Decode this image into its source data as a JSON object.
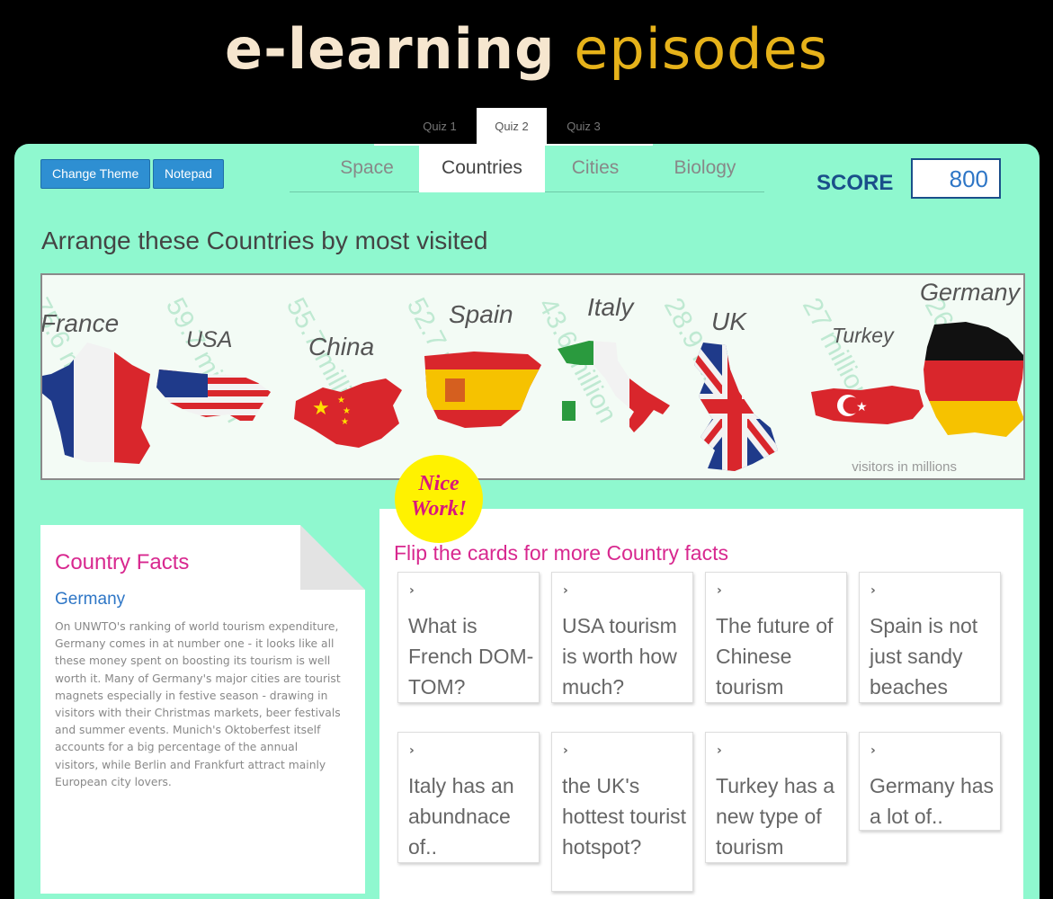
{
  "logo": {
    "word1": "e-learning",
    "word2": "episodes"
  },
  "quiz_tabs": [
    "Quiz 1",
    "Quiz 2",
    "Quiz 3"
  ],
  "quiz_active": "Quiz 2",
  "buttons": {
    "change_theme": "Change Theme",
    "notepad": "Notepad"
  },
  "subject_tabs": [
    "Space",
    "Countries",
    "Cities",
    "Biology"
  ],
  "subject_active": "Countries",
  "score": {
    "label": "SCORE",
    "value": "800"
  },
  "arrange_title": "Arrange these Countries by most visited",
  "countries": [
    {
      "name": "France",
      "visitors": "75.6 million"
    },
    {
      "name": "USA",
      "visitors": "59.7 million"
    },
    {
      "name": "China",
      "visitors": "55.7 million"
    },
    {
      "name": "Spain",
      "visitors": "52.7 million"
    },
    {
      "name": "Italy",
      "visitors": "43.6 million"
    },
    {
      "name": "UK",
      "visitors": "28.9 million"
    },
    {
      "name": "Turkey",
      "visitors": "27 million"
    },
    {
      "name": "Germany",
      "visitors": "26 million"
    }
  ],
  "visitors_note": "visitors in millions",
  "nice_work": {
    "line1": "Nice",
    "line2": "Work!"
  },
  "facts": {
    "title": "Country Facts",
    "country": "Germany",
    "text": "On UNWTO's ranking of world tourism expenditure, Germany comes in at number one - it looks like all these money spent on boosting its tourism is well worth it. Many of Germany's major cities are tourist magnets especially in festive season - drawing in visitors with their Christmas markets, beer festivals and summer events. Munich's Oktoberfest itself accounts for a big percentage of the annual visitors, while Berlin and Frankfurt attract mainly European city lovers."
  },
  "cards_title": "Flip the cards for more Country facts",
  "cards": [
    "What is French DOM-TOM?",
    "USA tourism is worth how much?",
    "The future of Chinese tourism",
    "Spain is not just sandy beaches",
    "Italy has an abundnace of..",
    "the UK's hottest tourist hotspot?",
    "Turkey has a new type of tourism",
    "Germany has a lot of.."
  ],
  "colors": {
    "panel": "#8ff8cf",
    "accent_blue": "#2e8fd2",
    "score_blue": "#1a4f8a",
    "pink": "#d8288f",
    "logo_gold": "#e6b21a"
  }
}
